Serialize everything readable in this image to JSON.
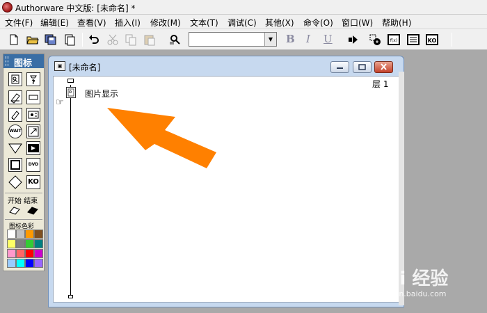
{
  "app": {
    "title": "Authorware 中文版: [未命名] *"
  },
  "menubar": {
    "items": [
      {
        "label": "文件(F)"
      },
      {
        "label": "编辑(E)"
      },
      {
        "label": "查看(V)"
      },
      {
        "label": "插入(I)"
      },
      {
        "label": "修改(M)"
      },
      {
        "label": "文本(T)"
      },
      {
        "label": "调试(C)"
      },
      {
        "label": "其他(X)"
      },
      {
        "label": "命令(O)"
      },
      {
        "label": "窗口(W)"
      },
      {
        "label": "帮助(H)"
      }
    ]
  },
  "toolbar": {
    "font_select_value": "",
    "bold_label": "B",
    "italic_label": "I",
    "underline_label": "U",
    "fx_label": "f(x)",
    "ko_label": "KO"
  },
  "palette": {
    "title": "图标",
    "start_label": "开始",
    "end_label": "结束",
    "color_label": "图标色彩",
    "icon_names": [
      "display",
      "motion",
      "erase",
      "wait",
      "navigate",
      "framework",
      "decision",
      "interaction",
      "calculation",
      "map",
      "digital-movie",
      "sound",
      "dvd",
      "knowledge-object"
    ],
    "wait_text": "WAIT",
    "dvd_text": "DVD",
    "ko_text": "KO",
    "colors": [
      "#ffffff",
      "#c0c0c0",
      "#ff9900",
      "#7f4f1f",
      "#ffff66",
      "#808080",
      "#33cc33",
      "#008080",
      "#ff99cc",
      "#ff6666",
      "#ff0000",
      "#cc00cc",
      "#99ccff",
      "#00ffff",
      "#0000ff",
      "#9966ff"
    ]
  },
  "document": {
    "title": "[未命名]",
    "level_label": "层 1",
    "icon_label": "图片显示"
  },
  "annotation": {
    "arrow_color": "#ff8000"
  },
  "watermark": {
    "brand": "Bai 经验",
    "url": "jingyan.baidu.com"
  }
}
